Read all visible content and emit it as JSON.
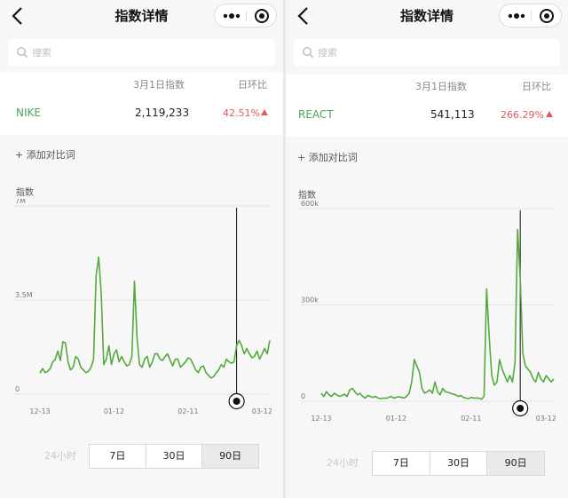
{
  "panels": [
    {
      "header": {
        "title": "指数详情"
      },
      "search": {
        "placeholder": "搜索"
      },
      "table": {
        "date_header": "3月1日指数",
        "ratio_header": "日环比",
        "row": {
          "keyword": "NIKE",
          "value": "2,119,233",
          "change": "42.51%",
          "trend": "up"
        }
      },
      "add_compare_label": "+ 添加对比词",
      "chart_label": "指数",
      "tabs": {
        "h24": "24小时",
        "d7": "7日",
        "d30": "30日",
        "d90": "90日",
        "active": "90日"
      }
    },
    {
      "header": {
        "title": "指数详情"
      },
      "search": {
        "placeholder": "搜索"
      },
      "table": {
        "date_header": "3月1日指数",
        "ratio_header": "日环比",
        "row": {
          "keyword": "REACT",
          "value": "541,113",
          "change": "266.29%",
          "trend": "up"
        }
      },
      "add_compare_label": "+ 添加对比词",
      "chart_label": "指数",
      "tabs": {
        "h24": "24小时",
        "d7": "7日",
        "d30": "30日",
        "d90": "90日",
        "active": "90日"
      }
    }
  ],
  "colors": {
    "line": "#55aa3c",
    "up": "#e05a5a",
    "keyword": "#51a451"
  },
  "chart_data": [
    {
      "type": "line",
      "title": "",
      "ylabel": "指数",
      "yticks": [
        "0",
        "3.5M",
        "7M"
      ],
      "ylim": [
        0,
        7000000
      ],
      "xticks": [
        "12-13",
        "01-12",
        "02-11",
        "03-12"
      ],
      "x_days": 90,
      "cursor_day": 77,
      "series": [
        {
          "values": [
            780000,
            950000,
            800000,
            850000,
            950000,
            1200000,
            1300000,
            1600000,
            1250000,
            1950000,
            1900000,
            1200000,
            900000,
            1000000,
            1400000,
            1300000,
            1000000,
            900000,
            800000,
            850000,
            1000000,
            1300000,
            4400000,
            5100000,
            3700000,
            1100000,
            1300000,
            1800000,
            1100000,
            1500000,
            1650000,
            1200000,
            1400000,
            1200000,
            1050000,
            1100000,
            1400000,
            4200000,
            2100000,
            1100000,
            1000000,
            1300000,
            1400000,
            1000000,
            1200000,
            1500000,
            1500000,
            1300000,
            1250000,
            1400000,
            1500000,
            1250000,
            1050000,
            1300000,
            1300000,
            1000000,
            1100000,
            1200000,
            1350000,
            1300000,
            1100000,
            900000,
            800000,
            1000000,
            1050000,
            800000,
            700000,
            600000,
            650000,
            800000,
            900000,
            1100000,
            1000000,
            1300000,
            1200000,
            1150000,
            1200000,
            1800000,
            2000000,
            1800000,
            1500000,
            1700000,
            1500000,
            1350000,
            1400000,
            1600000,
            1300000,
            1500000,
            1700000,
            1500000,
            2000000
          ]
        }
      ]
    },
    {
      "type": "line",
      "title": "",
      "ylabel": "指数",
      "yticks": [
        "0",
        "300k",
        "600k"
      ],
      "ylim": [
        0,
        600000
      ],
      "xticks": [
        "12-13",
        "01-12",
        "02-11",
        "03-12"
      ],
      "x_days": 90,
      "cursor_day": 77,
      "series": [
        {
          "values": [
            25000,
            15000,
            30000,
            20000,
            15000,
            25000,
            20000,
            15000,
            18000,
            22000,
            15000,
            35000,
            40000,
            30000,
            20000,
            25000,
            15000,
            10000,
            18000,
            15000,
            12000,
            15000,
            10000,
            8000,
            10000,
            9000,
            12000,
            15000,
            10000,
            12000,
            14000,
            12000,
            10000,
            15000,
            25000,
            60000,
            130000,
            110000,
            90000,
            40000,
            25000,
            30000,
            35000,
            25000,
            60000,
            30000,
            20000,
            40000,
            30000,
            28000,
            25000,
            22000,
            20000,
            15000,
            18000,
            12000,
            10000,
            8000,
            12000,
            10000,
            10000,
            10000,
            6000,
            15000,
            350000,
            200000,
            80000,
            50000,
            60000,
            130000,
            100000,
            80000,
            60000,
            80000,
            60000,
            120000,
            535000,
            380000,
            150000,
            110000,
            100000,
            90000,
            70000,
            60000,
            90000,
            70000,
            60000,
            80000,
            70000,
            60000,
            70000
          ]
        }
      ]
    }
  ]
}
